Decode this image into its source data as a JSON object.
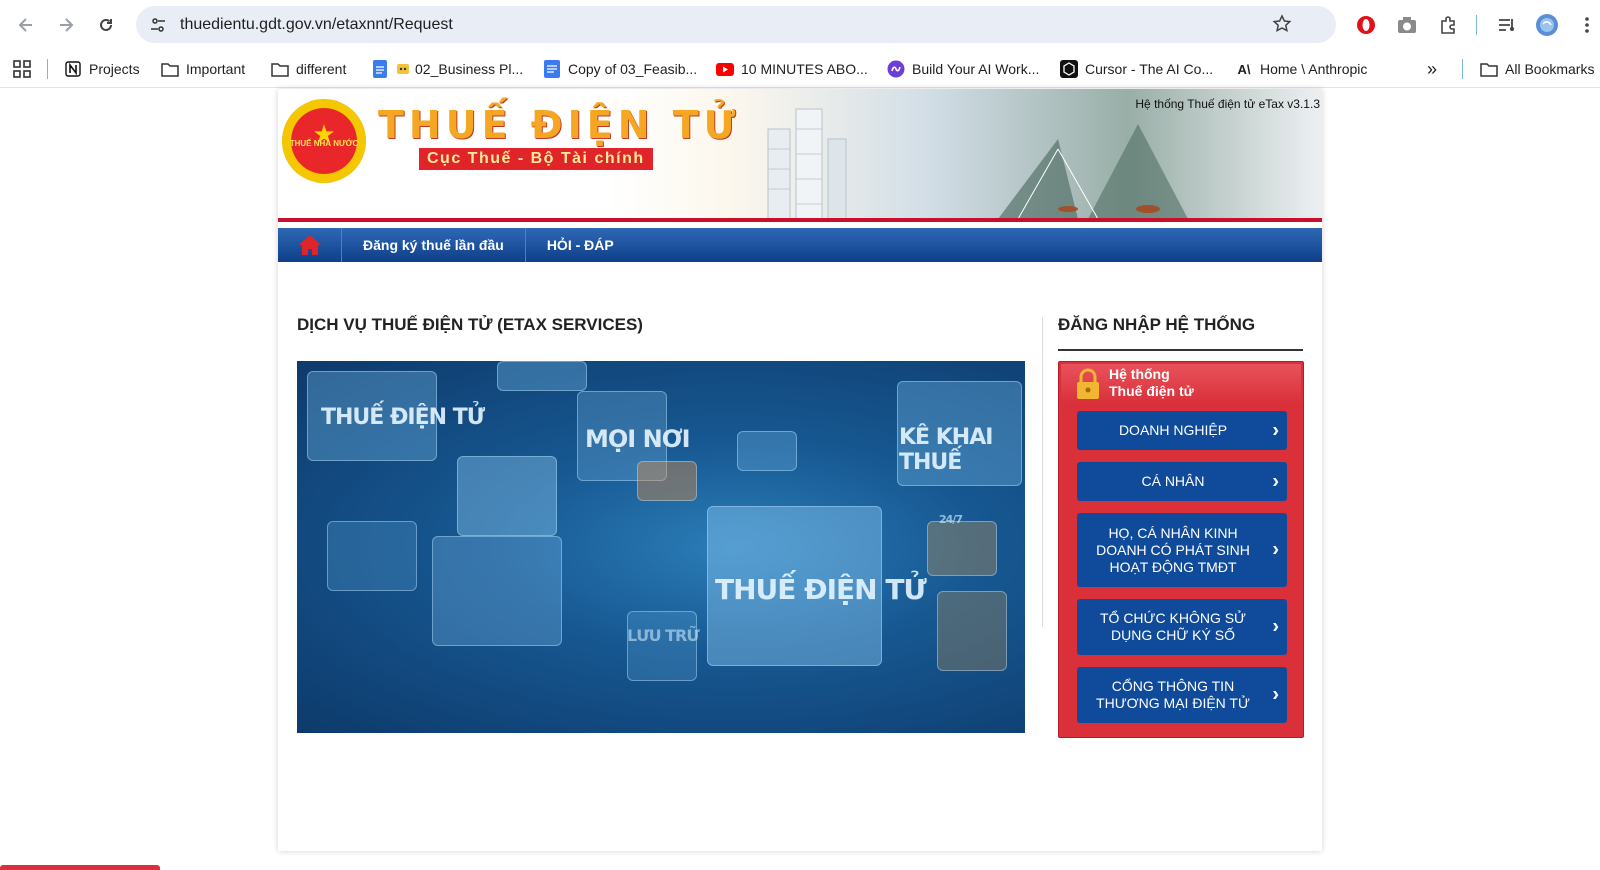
{
  "browser": {
    "url": "thuedientu.gdt.gov.vn/etaxnnt/Request",
    "bookmarks": [
      {
        "label": "Projects",
        "icon": "notion-icon"
      },
      {
        "label": "Important",
        "icon": "folder-icon"
      },
      {
        "label": "different",
        "icon": "folder-icon"
      },
      {
        "label": "02_Business Pl...",
        "icon": "docs-icon"
      },
      {
        "label": "Copy of 03_Feasib...",
        "icon": "docs-icon"
      },
      {
        "label": "10 MINUTES ABO...",
        "icon": "youtube-icon"
      },
      {
        "label": "Build Your AI Work...",
        "icon": "site-icon"
      },
      {
        "label": "Cursor - The AI Co...",
        "icon": "cursor-icon"
      },
      {
        "label": "Home \\ Anthropic",
        "icon": "anthropic-icon"
      }
    ],
    "all_bookmarks": "All Bookmarks",
    "overflow": "»"
  },
  "header": {
    "brand_title": "THUẾ ĐIỆN TỬ",
    "brand_subtitle": "Cục Thuế - Bộ Tài chính",
    "emblem_text": "THUẾ NHÀ NƯỚC",
    "version": "Hệ thống Thuế điện tử eTax v3.1.3"
  },
  "menu": {
    "items": [
      "Đăng ký thuế lần đầu",
      "HỎI - ĐÁP"
    ]
  },
  "services": {
    "title": "DỊCH VỤ THUẾ ĐIỆN TỬ (ETAX SERVICES)",
    "hero_labels": [
      "THUẾ ĐIỆN TỬ",
      "MỌI NƠI",
      "KÊ KHAI THUẾ",
      "THUẾ ĐIỆN TỬ",
      "LƯU TRỮ",
      "24/7"
    ]
  },
  "login": {
    "title": "ĐĂNG NHẬP HỆ THỐNG",
    "box_heading_line1": "Hệ thống",
    "box_heading_line2": "Thuế điện tử",
    "buttons": [
      "DOANH NGHIỆP",
      "CÁ NHÂN",
      "HỌ, CÁ NHÂN KINH DOANH CÓ PHÁT SINH HOẠT ĐỘNG TMĐT",
      "TỔ CHỨC KHÔNG SỬ DỤNG CHỮ KÝ SỐ",
      "CỔNG THÔNG TIN THƯƠNG MẠI ĐIỆN TỬ"
    ]
  },
  "colors": {
    "menu_blue": "#0e3f8a",
    "login_red": "#d9303a",
    "button_blue": "#0f4b9a",
    "brand_orange": "#f5a623"
  }
}
